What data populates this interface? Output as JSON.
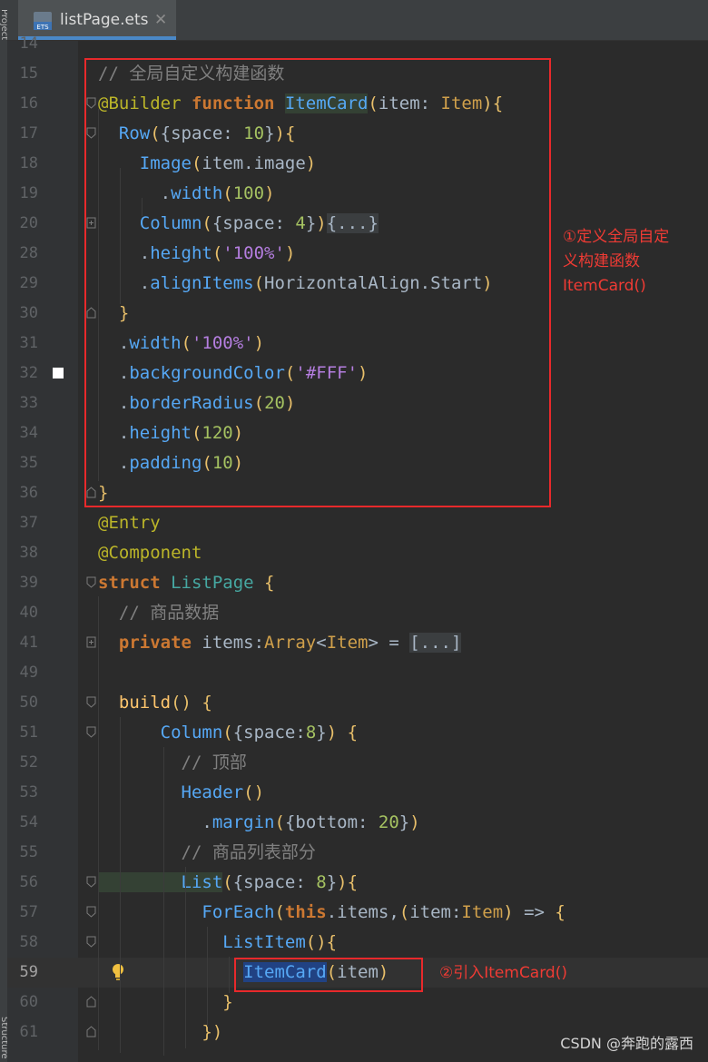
{
  "sidebar": {
    "label_top": "Project",
    "label_bottom": "Structure"
  },
  "tab": {
    "icon_label": "ETS",
    "filename": "listPage.ets",
    "close": "✕"
  },
  "annotations": {
    "note1_line1": "①定义全局自定",
    "note1_line2": "义构建函数",
    "note1_line3": "ItemCard()",
    "note2": "②引入ItemCard()"
  },
  "watermark": "CSDN @奔跑的露西",
  "colors": {
    "annotation_red": "#e8292b",
    "tab_underline": "#4a88c7",
    "selection": "#214283"
  },
  "lines": [
    {
      "n": "14",
      "segs": []
    },
    {
      "n": "15",
      "segs": [
        {
          "c": "cmt",
          "t": "// 全局自定义构建函数"
        }
      ]
    },
    {
      "n": "16",
      "segs": [
        {
          "c": "dec",
          "t": "@Builder "
        },
        {
          "c": "kw",
          "t": "function "
        },
        {
          "c": "call hlid",
          "t": "ItemCard"
        },
        {
          "c": "par",
          "t": "("
        },
        {
          "c": "",
          "t": "item: "
        },
        {
          "c": "type",
          "t": "Item"
        },
        {
          "c": "par",
          "t": "){"
        }
      ]
    },
    {
      "n": "17",
      "segs": [
        {
          "c": "call",
          "t": "  Row"
        },
        {
          "c": "par",
          "t": "("
        },
        {
          "c": "",
          "t": "{space: "
        },
        {
          "c": "num2",
          "t": "10"
        },
        {
          "c": "",
          "t": "}"
        },
        {
          "c": "par",
          "t": "){"
        }
      ]
    },
    {
      "n": "18",
      "segs": [
        {
          "c": "call",
          "t": "    Image"
        },
        {
          "c": "par",
          "t": "("
        },
        {
          "c": "",
          "t": "item.image"
        },
        {
          "c": "par",
          "t": ")"
        }
      ]
    },
    {
      "n": "19",
      "segs": [
        {
          "c": "",
          "t": "      ."
        },
        {
          "c": "call",
          "t": "width"
        },
        {
          "c": "par",
          "t": "("
        },
        {
          "c": "num2",
          "t": "100"
        },
        {
          "c": "par",
          "t": ")"
        }
      ]
    },
    {
      "n": "20",
      "segs": [
        {
          "c": "call",
          "t": "    Column"
        },
        {
          "c": "par",
          "t": "("
        },
        {
          "c": "",
          "t": "{space: "
        },
        {
          "c": "num2",
          "t": "4"
        },
        {
          "c": "",
          "t": "}"
        },
        {
          "c": "par",
          "t": ")"
        },
        {
          "c": "ph",
          "t": "{...}"
        }
      ]
    },
    {
      "n": "28",
      "segs": [
        {
          "c": "",
          "t": "    ."
        },
        {
          "c": "call",
          "t": "height"
        },
        {
          "c": "par",
          "t": "("
        },
        {
          "c": "str",
          "t": "'100%'"
        },
        {
          "c": "par",
          "t": ")"
        }
      ]
    },
    {
      "n": "29",
      "segs": [
        {
          "c": "",
          "t": "    ."
        },
        {
          "c": "call",
          "t": "alignItems"
        },
        {
          "c": "par",
          "t": "("
        },
        {
          "c": "",
          "t": "HorizontalAlign.Start"
        },
        {
          "c": "par",
          "t": ")"
        }
      ]
    },
    {
      "n": "30",
      "segs": [
        {
          "c": "par",
          "t": "  }"
        }
      ]
    },
    {
      "n": "31",
      "segs": [
        {
          "c": "",
          "t": "  ."
        },
        {
          "c": "call",
          "t": "width"
        },
        {
          "c": "par",
          "t": "("
        },
        {
          "c": "str",
          "t": "'100%'"
        },
        {
          "c": "par",
          "t": ")"
        }
      ]
    },
    {
      "n": "32",
      "segs": [
        {
          "c": "",
          "t": "  ."
        },
        {
          "c": "call",
          "t": "backgroundColor"
        },
        {
          "c": "par",
          "t": "("
        },
        {
          "c": "str",
          "t": "'#FFF'"
        },
        {
          "c": "par",
          "t": ")"
        }
      ]
    },
    {
      "n": "33",
      "segs": [
        {
          "c": "",
          "t": "  ."
        },
        {
          "c": "call",
          "t": "borderRadius"
        },
        {
          "c": "par",
          "t": "("
        },
        {
          "c": "num2",
          "t": "20"
        },
        {
          "c": "par",
          "t": ")"
        }
      ]
    },
    {
      "n": "34",
      "segs": [
        {
          "c": "",
          "t": "  ."
        },
        {
          "c": "call",
          "t": "height"
        },
        {
          "c": "par",
          "t": "("
        },
        {
          "c": "num2",
          "t": "120"
        },
        {
          "c": "par",
          "t": ")"
        }
      ]
    },
    {
      "n": "35",
      "segs": [
        {
          "c": "",
          "t": "  ."
        },
        {
          "c": "call",
          "t": "padding"
        },
        {
          "c": "par",
          "t": "("
        },
        {
          "c": "num2",
          "t": "10"
        },
        {
          "c": "par",
          "t": ")"
        }
      ]
    },
    {
      "n": "36",
      "segs": [
        {
          "c": "par",
          "t": "}"
        }
      ]
    },
    {
      "n": "37",
      "segs": [
        {
          "c": "dec",
          "t": "@Entry"
        }
      ]
    },
    {
      "n": "38",
      "segs": [
        {
          "c": "dec",
          "t": "@Component"
        }
      ]
    },
    {
      "n": "39",
      "segs": [
        {
          "c": "kw",
          "t": "struct "
        },
        {
          "c": "cls",
          "t": "ListPage "
        },
        {
          "c": "par",
          "t": "{"
        }
      ]
    },
    {
      "n": "40",
      "segs": [
        {
          "c": "cmt",
          "t": "  // 商品数据"
        }
      ]
    },
    {
      "n": "41",
      "segs": [
        {
          "c": "kw",
          "t": "  private "
        },
        {
          "c": "",
          "t": "items:"
        },
        {
          "c": "type",
          "t": "Array"
        },
        {
          "c": "",
          "t": "<"
        },
        {
          "c": "type",
          "t": "Item"
        },
        {
          "c": "",
          "t": "> = "
        },
        {
          "c": "ph",
          "t": "[...]"
        }
      ]
    },
    {
      "n": "49",
      "segs": []
    },
    {
      "n": "50",
      "segs": [
        {
          "c": "fn",
          "t": "  build"
        },
        {
          "c": "par",
          "t": "() {"
        }
      ]
    },
    {
      "n": "51",
      "segs": [
        {
          "c": "call",
          "t": "      Column"
        },
        {
          "c": "par",
          "t": "("
        },
        {
          "c": "",
          "t": "{space:"
        },
        {
          "c": "num2",
          "t": "8"
        },
        {
          "c": "",
          "t": "}"
        },
        {
          "c": "par",
          "t": ") {"
        }
      ]
    },
    {
      "n": "52",
      "segs": [
        {
          "c": "cmt",
          "t": "        // 顶部"
        }
      ]
    },
    {
      "n": "53",
      "segs": [
        {
          "c": "call",
          "t": "        Header"
        },
        {
          "c": "par",
          "t": "()"
        }
      ]
    },
    {
      "n": "54",
      "segs": [
        {
          "c": "",
          "t": "          ."
        },
        {
          "c": "call",
          "t": "margin"
        },
        {
          "c": "par",
          "t": "("
        },
        {
          "c": "",
          "t": "{bottom: "
        },
        {
          "c": "num2",
          "t": "20"
        },
        {
          "c": "",
          "t": "}"
        },
        {
          "c": "par",
          "t": ")"
        }
      ]
    },
    {
      "n": "55",
      "segs": [
        {
          "c": "cmt",
          "t": "        // 商品列表部分"
        }
      ]
    },
    {
      "n": "56",
      "segs": [
        {
          "c": "call hlid",
          "t": "        List"
        },
        {
          "c": "par",
          "t": "("
        },
        {
          "c": "",
          "t": "{space: "
        },
        {
          "c": "num2",
          "t": "8"
        },
        {
          "c": "",
          "t": "}"
        },
        {
          "c": "par",
          "t": "){"
        }
      ]
    },
    {
      "n": "57",
      "segs": [
        {
          "c": "call",
          "t": "          ForEach"
        },
        {
          "c": "par",
          "t": "("
        },
        {
          "c": "kw",
          "t": "this"
        },
        {
          "c": "",
          "t": ".items,"
        },
        {
          "c": "par",
          "t": "("
        },
        {
          "c": "",
          "t": "item:"
        },
        {
          "c": "type",
          "t": "Item"
        },
        {
          "c": "par",
          "t": ")"
        },
        {
          "c": "",
          "t": " => "
        },
        {
          "c": "par",
          "t": "{"
        }
      ]
    },
    {
      "n": "58",
      "segs": [
        {
          "c": "call",
          "t": "            ListItem"
        },
        {
          "c": "par",
          "t": "(){"
        }
      ]
    },
    {
      "n": "59",
      "segs": [
        {
          "c": "",
          "t": "              "
        },
        {
          "c": "call sel",
          "t": "ItemCard"
        },
        {
          "c": "par",
          "t": "("
        },
        {
          "c": "",
          "t": "item"
        },
        {
          "c": "par",
          "t": ")"
        }
      ]
    },
    {
      "n": "60",
      "segs": [
        {
          "c": "par",
          "t": "            }"
        }
      ]
    },
    {
      "n": "61",
      "segs": [
        {
          "c": "par",
          "t": "          })"
        }
      ]
    }
  ]
}
